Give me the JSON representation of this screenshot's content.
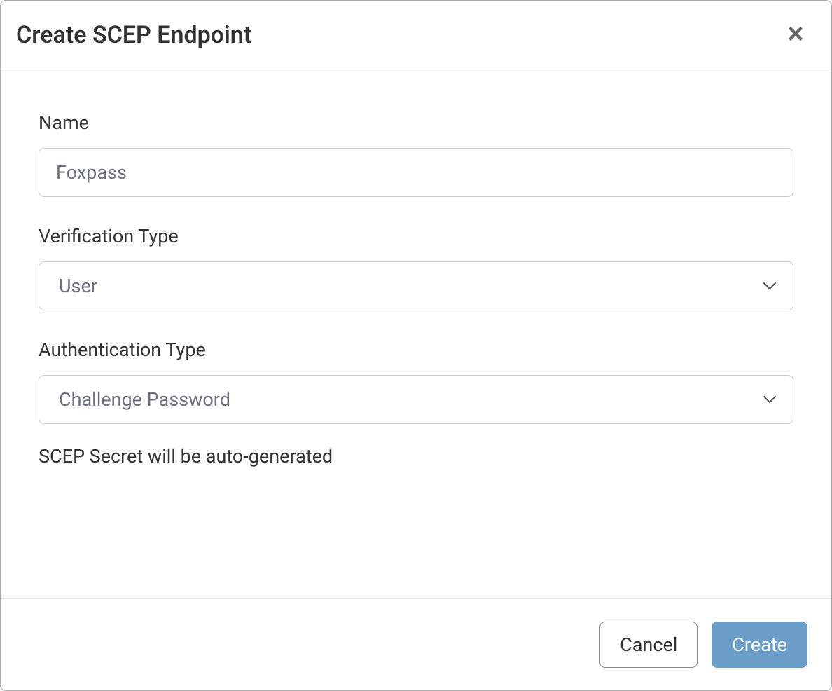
{
  "modal": {
    "title": "Create SCEP Endpoint"
  },
  "form": {
    "name": {
      "label": "Name",
      "placeholder": "Foxpass",
      "value": ""
    },
    "verification_type": {
      "label": "Verification Type",
      "selected": "User"
    },
    "authentication_type": {
      "label": "Authentication Type",
      "selected": "Challenge Password"
    },
    "helper_text": "SCEP Secret will be auto-generated"
  },
  "footer": {
    "cancel_label": "Cancel",
    "create_label": "Create"
  }
}
